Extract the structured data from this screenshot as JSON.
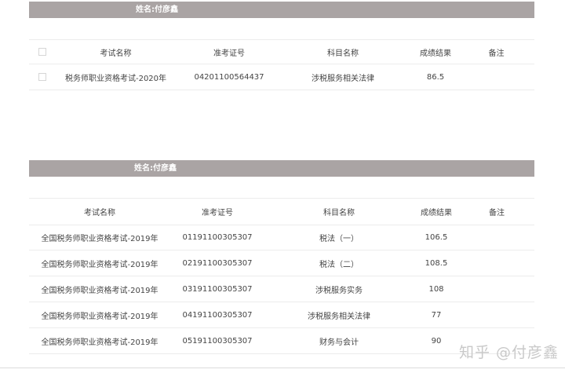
{
  "panel1": {
    "header": "姓名:付彦鑫",
    "columns": [
      "考试名称",
      "准考证号",
      "科目名称",
      "成绩结果",
      "备注"
    ],
    "rows": [
      [
        "税务师职业资格考试-2020年",
        "04201100564437",
        "涉税服务相关法律",
        "86.5",
        ""
      ]
    ]
  },
  "panel2": {
    "header": "姓名:付彦鑫",
    "columns": [
      "考试名称",
      "准考证号",
      "科目名称",
      "成绩结果",
      "备注"
    ],
    "rows": [
      [
        "全国税务师职业资格考试-2019年",
        "01191100305307",
        "税法（一）",
        "106.5",
        ""
      ],
      [
        "全国税务师职业资格考试-2019年",
        "02191100305307",
        "税法（二）",
        "108.5",
        ""
      ],
      [
        "全国税务师职业资格考试-2019年",
        "03191100305307",
        "涉税服务实务",
        "108",
        ""
      ],
      [
        "全国税务师职业资格考试-2019年",
        "04191100305307",
        "涉税服务相关法律",
        "77",
        ""
      ],
      [
        "全国税务师职业资格考试-2019年",
        "05191100305307",
        "财务与会计",
        "90",
        ""
      ]
    ]
  },
  "watermark": "知乎 @付彦鑫"
}
